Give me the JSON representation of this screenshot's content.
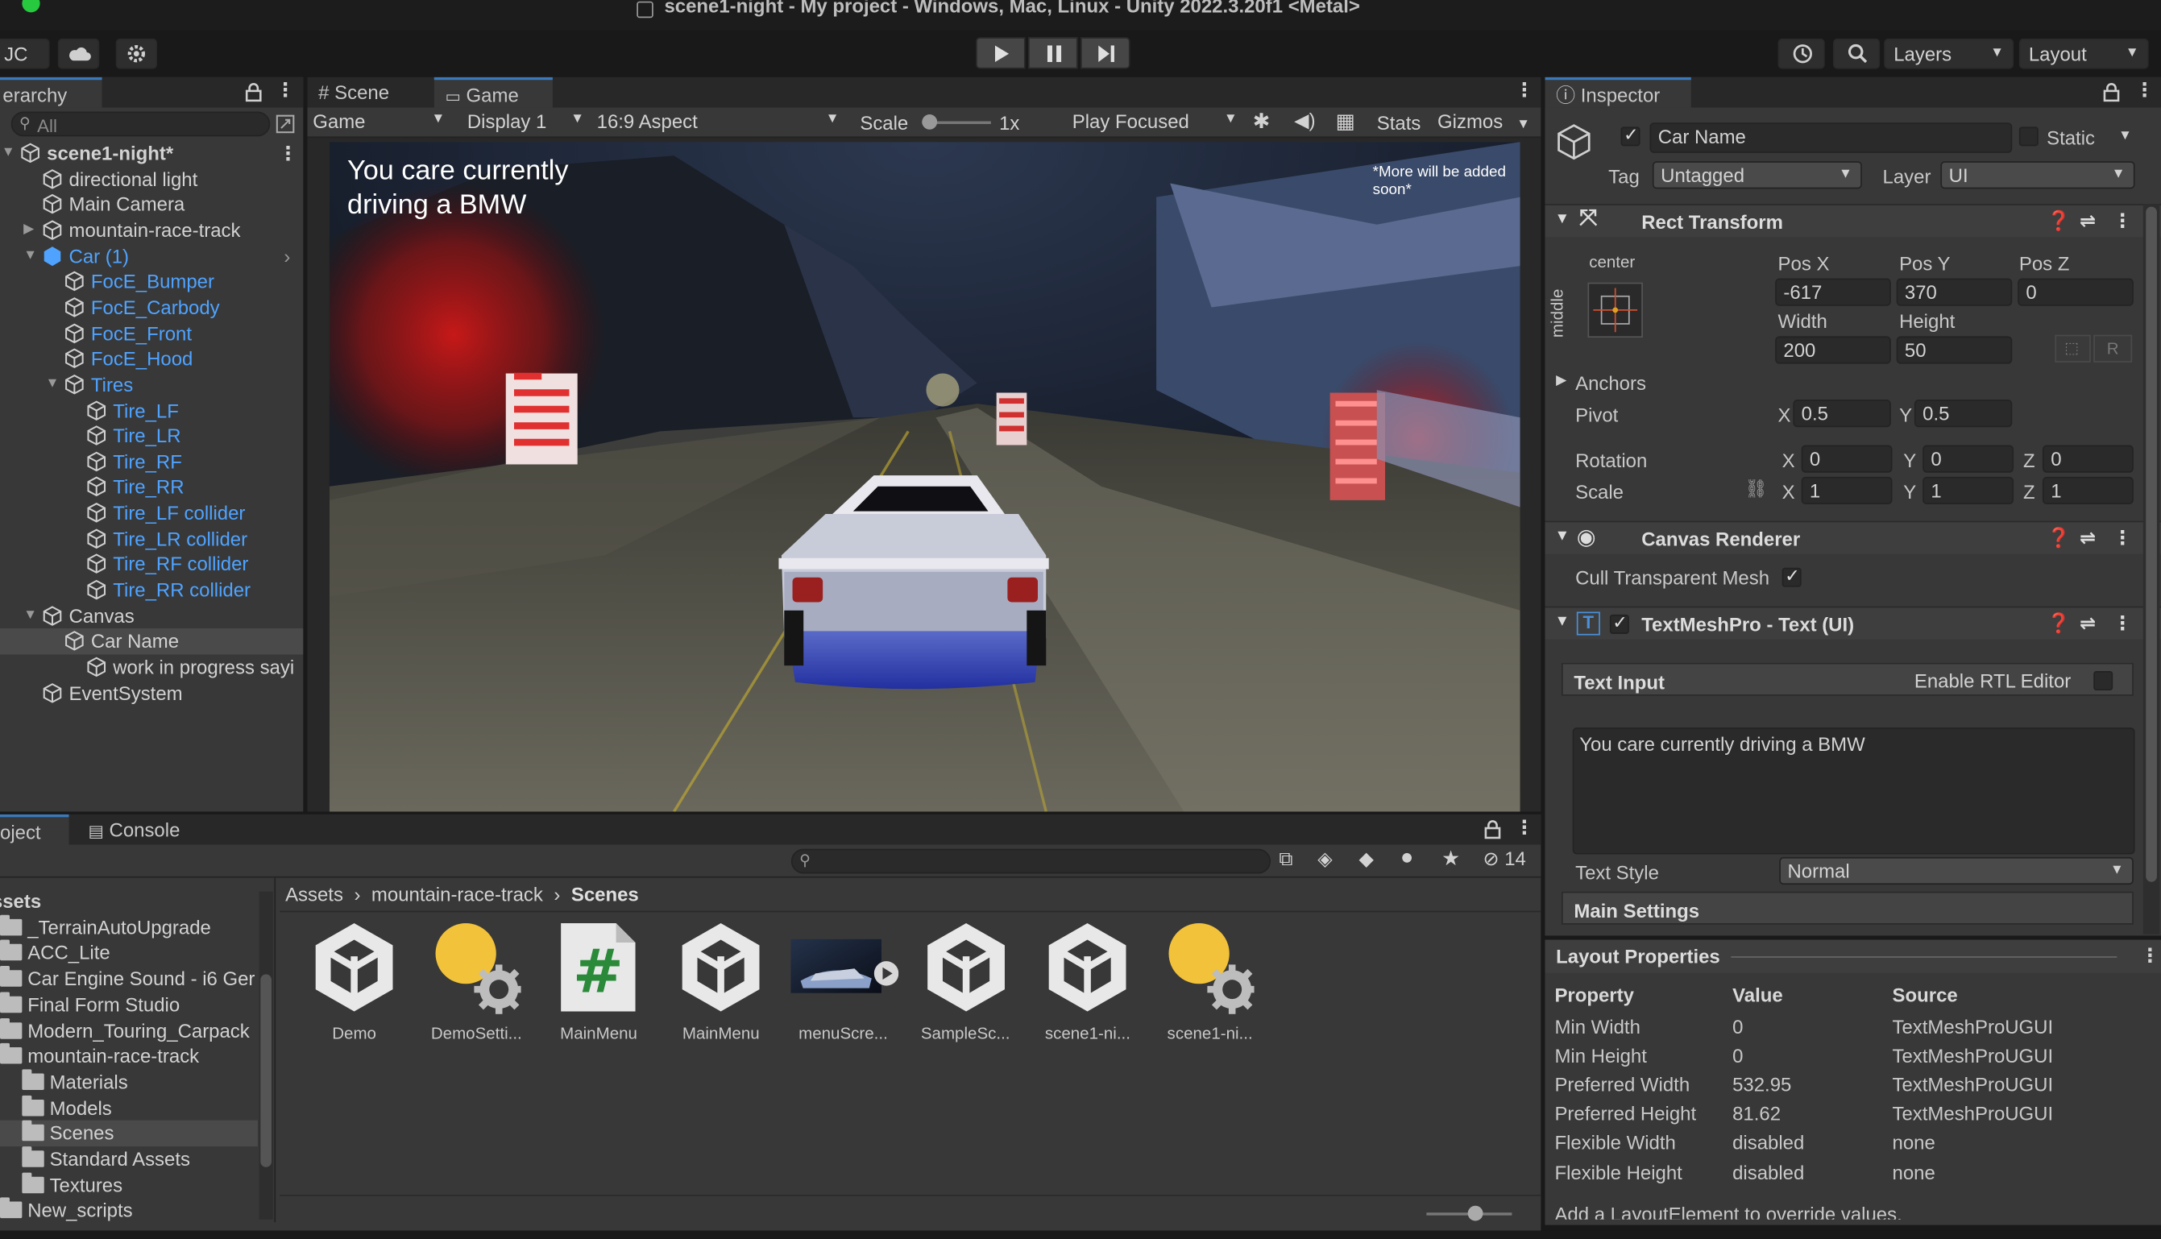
{
  "window": {
    "title": "scene1-night - My project - Windows, Mac, Linux - Unity 2022.3.20f1 <Metal>"
  },
  "toolbar": {
    "account": "JC",
    "layers": "Layers",
    "layout": "Layout"
  },
  "hierarchy": {
    "tab": "erarchy",
    "search_placeholder": "All",
    "items": [
      {
        "label": "scene1-night*",
        "depth": 0
      },
      {
        "label": "directional light",
        "depth": 1
      },
      {
        "label": "Main Camera",
        "depth": 1
      },
      {
        "label": "mountain-race-track",
        "depth": 1
      },
      {
        "label": "Car (1)",
        "depth": 1
      },
      {
        "label": "FocE_Bumper",
        "depth": 2
      },
      {
        "label": "FocE_Carbody",
        "depth": 2
      },
      {
        "label": "FocE_Front",
        "depth": 2
      },
      {
        "label": "FocE_Hood",
        "depth": 2
      },
      {
        "label": "Tires",
        "depth": 2
      },
      {
        "label": "Tire_LF",
        "depth": 3
      },
      {
        "label": "Tire_LR",
        "depth": 3
      },
      {
        "label": "Tire_RF",
        "depth": 3
      },
      {
        "label": "Tire_RR",
        "depth": 3
      },
      {
        "label": "Tire_LF collider",
        "depth": 3
      },
      {
        "label": "Tire_LR collider",
        "depth": 3
      },
      {
        "label": "Tire_RF collider",
        "depth": 3
      },
      {
        "label": "Tire_RR collider",
        "depth": 3
      },
      {
        "label": "Canvas",
        "depth": 1
      },
      {
        "label": "Car Name",
        "depth": 2
      },
      {
        "label": "work in progress sayi",
        "depth": 3
      },
      {
        "label": "EventSystem",
        "depth": 1
      }
    ]
  },
  "game": {
    "tabs": {
      "scene": "Scene",
      "game": "Game"
    },
    "mode": "Game",
    "display": "Display 1",
    "aspect": "16:9 Aspect",
    "scale_label": "Scale",
    "scale_value": "1x",
    "play_focused": "Play Focused",
    "stats": "Stats",
    "gizmos": "Gizmos",
    "hud_text_line1": "You care currently",
    "hud_text_line2": "driving a BMW",
    "note_line1": "*More will be added",
    "note_line2": "soon*"
  },
  "project": {
    "tabs": {
      "project": "oject",
      "console": "Console"
    },
    "hidden_count": "14",
    "tree": [
      {
        "label": "Assets",
        "bold": true
      },
      {
        "label": "_TerrainAutoUpgrade"
      },
      {
        "label": "ACC_Lite"
      },
      {
        "label": "Car Engine Sound - i6 Ger"
      },
      {
        "label": "Final Form Studio"
      },
      {
        "label": "Modern_Touring_Carpack"
      },
      {
        "label": "mountain-race-track"
      },
      {
        "label": "Materials"
      },
      {
        "label": "Models"
      },
      {
        "label": "Scenes"
      },
      {
        "label": "Standard Assets"
      },
      {
        "label": "Textures"
      },
      {
        "label": "New_scripts"
      }
    ],
    "breadcrumb": [
      "Assets",
      "mountain-race-track",
      "Scenes"
    ],
    "assets": [
      {
        "label": "Demo",
        "icon": "unity-scene-icon"
      },
      {
        "label": "DemoSetti...",
        "icon": "lighting-settings-icon"
      },
      {
        "label": "MainMenu",
        "icon": "csharp-script-icon"
      },
      {
        "label": "MainMenu",
        "icon": "unity-scene-icon"
      },
      {
        "label": "menuScre...",
        "icon": "video-clip-icon"
      },
      {
        "label": "SampleSc...",
        "icon": "unity-scene-icon"
      },
      {
        "label": "scene1-ni...",
        "icon": "unity-scene-icon"
      },
      {
        "label": "scene1-ni...",
        "icon": "lighting-settings-icon"
      }
    ]
  },
  "inspector": {
    "tab": "Inspector",
    "object_name": "Car Name",
    "static_label": "Static",
    "tag_label": "Tag",
    "tag_value": "Untagged",
    "layer_label": "Layer",
    "layer_value": "UI",
    "rect_transform": {
      "title": "Rect Transform",
      "anchor_h": "center",
      "anchor_v": "middle",
      "posx_label": "Pos X",
      "posy_label": "Pos Y",
      "posz_label": "Pos Z",
      "posx": "-617",
      "posy": "370",
      "posz": "0",
      "width_label": "Width",
      "height_label": "Height",
      "width": "200",
      "height": "50",
      "anchors_label": "Anchors",
      "pivot_label": "Pivot",
      "pivot_x": "0.5",
      "pivot_y": "0.5",
      "rotation_label": "Rotation",
      "rot_x": "0",
      "rot_y": "0",
      "rot_z": "0",
      "scale_label": "Scale",
      "scale_x": "1",
      "scale_y": "1",
      "scale_z": "1",
      "x": "X",
      "y": "Y",
      "z": "Z",
      "r_button": "R"
    },
    "canvas_renderer": {
      "title": "Canvas Renderer",
      "cull_label": "Cull Transparent Mesh"
    },
    "tmp": {
      "title": "TextMeshPro - Text (UI)",
      "text_input_label": "Text Input",
      "rtl_label": "Enable RTL Editor",
      "text_value": "You care currently driving a BMW",
      "text_style_label": "Text Style",
      "text_style_value": "Normal",
      "main_settings": "Main Settings"
    },
    "layout_properties": {
      "title": "Layout Properties",
      "headers": [
        "Property",
        "Value",
        "Source"
      ],
      "rows": [
        [
          "Min Width",
          "0",
          "TextMeshProUGUI"
        ],
        [
          "Min Height",
          "0",
          "TextMeshProUGUI"
        ],
        [
          "Preferred Width",
          "532.95",
          "TextMeshProUGUI"
        ],
        [
          "Preferred Height",
          "81.62",
          "TextMeshProUGUI"
        ],
        [
          "Flexible Width",
          "disabled",
          "none"
        ],
        [
          "Flexible Height",
          "disabled",
          "none"
        ]
      ],
      "footer": "Add a LayoutElement to override values."
    }
  }
}
